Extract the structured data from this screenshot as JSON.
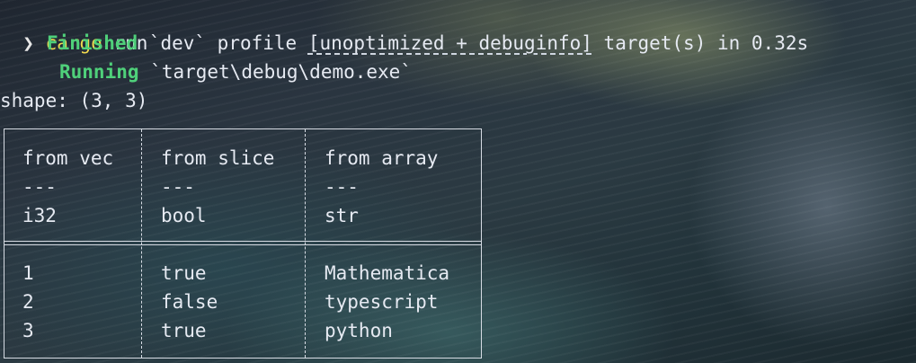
{
  "terminal": {
    "prompt_glyph": "❯",
    "command": "cargo",
    "command_args": "run",
    "finished_label": "Finished",
    "finished_pre": "`dev` profile ",
    "finished_profile": "[unoptimized + debuginfo]",
    "finished_post": " target(s) in 0.32s",
    "running_label": "Running",
    "running_text": "`target\\debug\\demo.exe`",
    "shape_line": "shape: (3, 3)"
  },
  "table": {
    "headers": [
      "from vec",
      "from slice",
      "from array"
    ],
    "separators": [
      "---",
      "---",
      "---"
    ],
    "dtypes": [
      "i32",
      "bool",
      "str"
    ],
    "rows": [
      [
        "1",
        "true",
        "Mathematica"
      ],
      [
        "2",
        "false",
        "typescript"
      ],
      [
        "3",
        "true",
        "python"
      ]
    ]
  },
  "colors": {
    "command": "#f2d94e",
    "status": "#4fd07a",
    "text": "#e6eaf2",
    "border": "#d7dce4"
  }
}
